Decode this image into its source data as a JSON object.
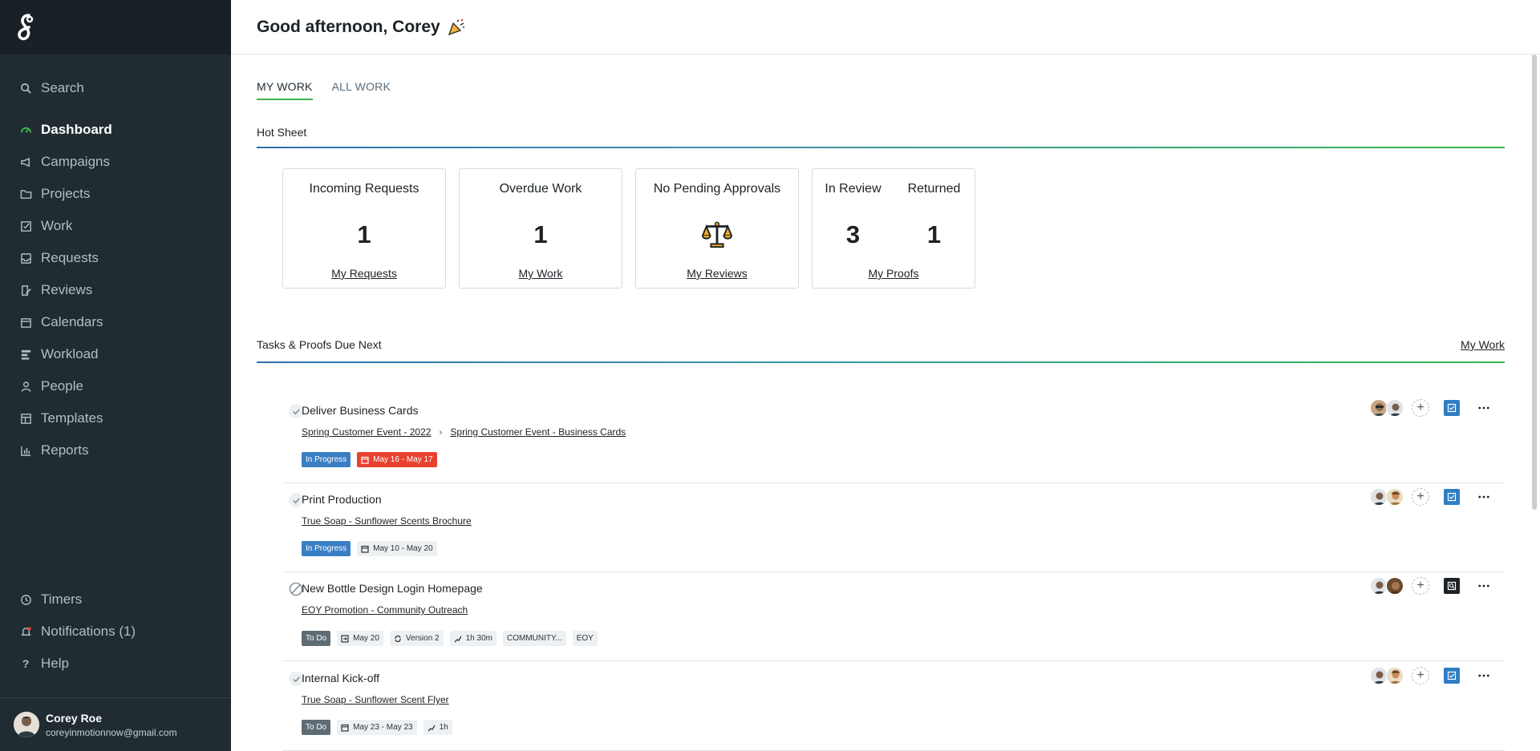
{
  "sidebar": {
    "nav": [
      {
        "label": "Search",
        "icon": "search-icon"
      },
      {
        "label": "Dashboard",
        "icon": "dashboard-gauge-icon",
        "active": true
      },
      {
        "label": "Campaigns",
        "icon": "megaphone-icon"
      },
      {
        "label": "Projects",
        "icon": "folder-icon"
      },
      {
        "label": "Work",
        "icon": "checkbox-icon"
      },
      {
        "label": "Requests",
        "icon": "inbox-icon"
      },
      {
        "label": "Reviews",
        "icon": "review-pen-icon"
      },
      {
        "label": "Calendars",
        "icon": "calendar-icon"
      },
      {
        "label": "Workload",
        "icon": "workload-bars-icon"
      },
      {
        "label": "People",
        "icon": "person-icon"
      },
      {
        "label": "Templates",
        "icon": "template-icon"
      },
      {
        "label": "Reports",
        "icon": "chart-icon"
      }
    ],
    "bottom_nav": [
      {
        "label": "Timers",
        "icon": "clock-icon"
      },
      {
        "label": "Notifications (1)",
        "icon": "bell-icon"
      },
      {
        "label": "Help",
        "icon": "question-icon"
      }
    ],
    "user": {
      "name": "Corey Roe",
      "email": "coreyinmotionnow@gmail.com"
    }
  },
  "header": {
    "greeting": "Good afternoon, Corey"
  },
  "tabs": [
    {
      "label": "MY WORK",
      "active": true
    },
    {
      "label": "ALL WORK"
    }
  ],
  "hot_sheet": {
    "title": "Hot Sheet",
    "cards": [
      {
        "title": "Incoming Requests",
        "value": "1",
        "link": "My Requests"
      },
      {
        "title": "Overdue Work",
        "value": "1",
        "link": "My Work"
      },
      {
        "title": "No Pending Approvals",
        "icon": "scales-icon",
        "link": "My Reviews"
      },
      {
        "title_left": "In Review",
        "value_left": "3",
        "title_right": "Returned",
        "value_right": "1",
        "link": "My Proofs"
      }
    ]
  },
  "tasks_section": {
    "title": "Tasks & Proofs Due Next",
    "link": "My Work",
    "tasks": [
      {
        "title": "Deliver Business Cards",
        "check": "done",
        "crumbs": [
          "Spring Customer Event - 2022",
          "Spring Customer Event - Business Cards"
        ],
        "status": "In Progress",
        "date": "May 16 - May 17",
        "date_overdue": true,
        "type": "task"
      },
      {
        "title": "Print Production",
        "check": "done",
        "crumbs": [
          "True Soap - Sunflower Scents Brochure"
        ],
        "status": "In Progress",
        "date": "May 10 - May 20",
        "type": "task"
      },
      {
        "title": "New Bottle Design Login Homepage",
        "check": "blocked",
        "crumbs": [
          "EOY Promotion - Community Outreach"
        ],
        "status": "To Do",
        "due": "May 20",
        "version": "Version 2",
        "estimate": "1h 30m",
        "labels": [
          "COMMUNITY...",
          "EOY"
        ],
        "type": "proof"
      },
      {
        "title": "Internal Kick-off",
        "check": "done",
        "crumbs": [
          "True Soap - Sunflower Scent Flyer"
        ],
        "status": "To Do",
        "date": "May 23 - May 23",
        "estimate": "1h",
        "type": "task"
      }
    ]
  },
  "colors": {
    "sidebar": "#202c32",
    "accent_green": "#3cb54a",
    "status_blue": "#3a7fc4",
    "overdue_red": "#e8412e"
  }
}
